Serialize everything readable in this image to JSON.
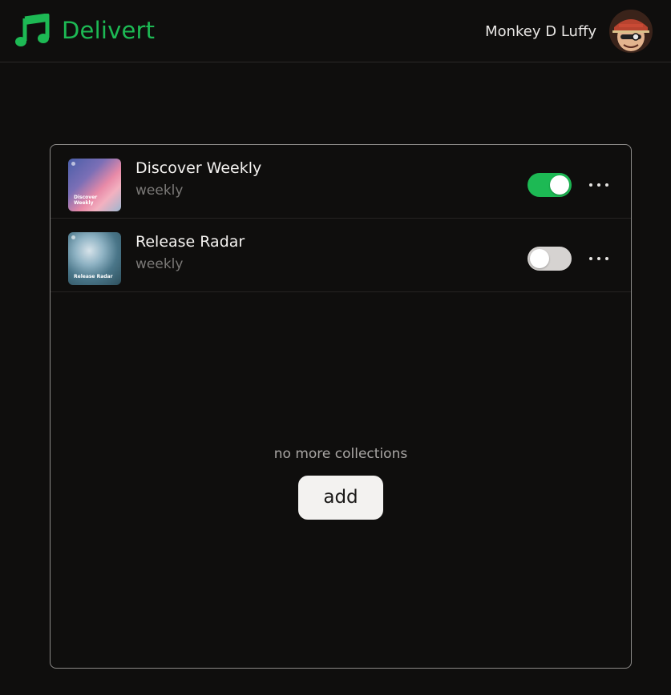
{
  "header": {
    "app_name": "Delivert",
    "logo_icon": "music-note-icon",
    "brand_color": "#1db954",
    "user": {
      "name": "Monkey D Luffy",
      "avatar_icon": "user-avatar"
    }
  },
  "collections": {
    "items": [
      {
        "title": "Discover Weekly",
        "subtitle": "weekly",
        "cover_label": "Discover Weekly",
        "enabled": true,
        "menu_icon": "more-horizontal-icon"
      },
      {
        "title": "Release Radar",
        "subtitle": "weekly",
        "cover_label": "Release Radar",
        "enabled": false,
        "menu_icon": "more-horizontal-icon"
      }
    ],
    "empty_message": "no more collections",
    "add_label": "add"
  },
  "colors": {
    "toggle_on": "#1db954",
    "toggle_off": "#d6d3d1",
    "background": "#0f0e0d"
  }
}
